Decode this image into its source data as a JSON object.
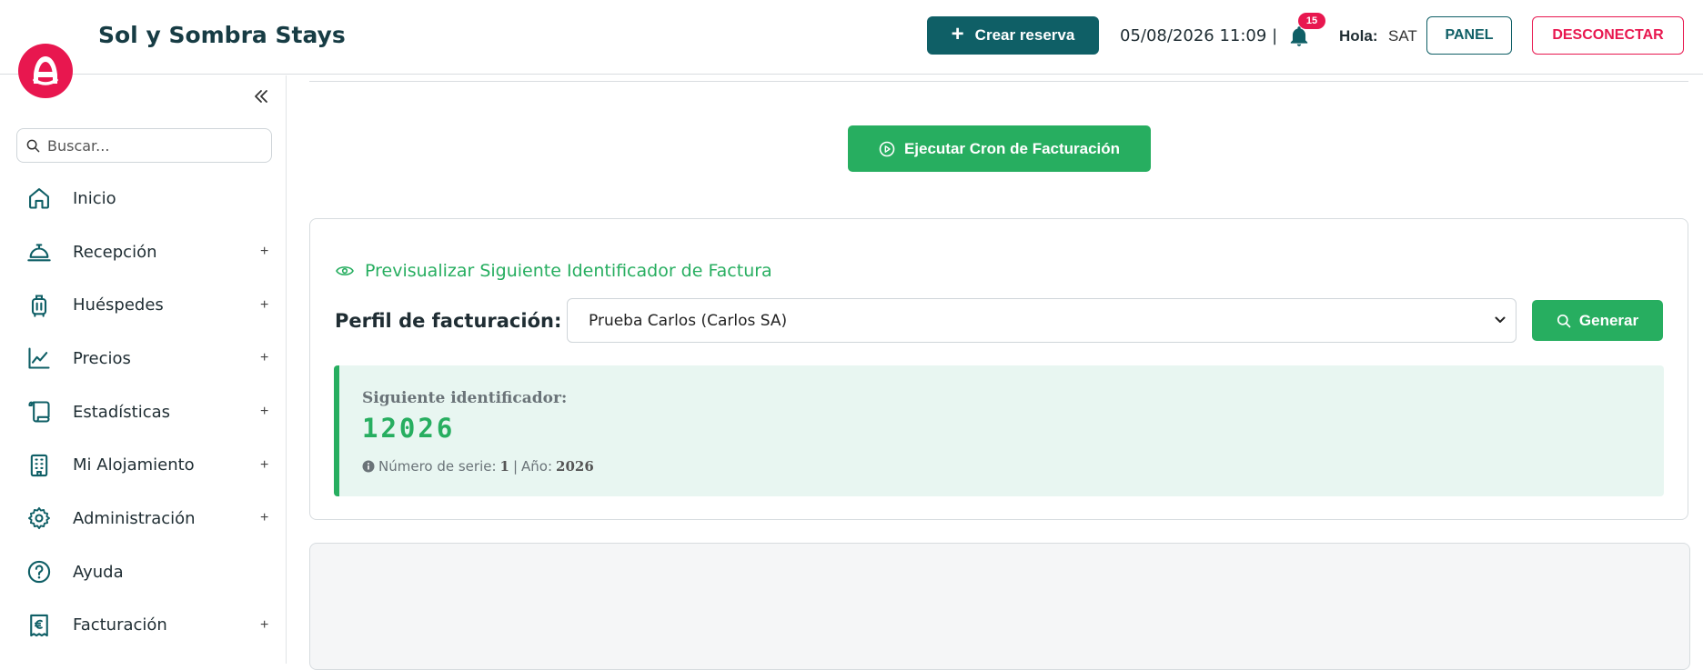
{
  "header": {
    "app_title": "Sol y Sombra Stays",
    "create_button": "Crear reserva",
    "datetime": "05/08/2026 11:09 |",
    "notifications_count": "15",
    "greeting_label": "Hola:",
    "user_name": "SAT",
    "panel_button": "PANEL",
    "logout_button": "DESCONECTAR"
  },
  "sidebar": {
    "search_placeholder": "Buscar...",
    "items": [
      {
        "label": "Inicio",
        "icon": "home-icon",
        "expand": ""
      },
      {
        "label": "Recepción",
        "icon": "bell-desk-icon",
        "expand": "+"
      },
      {
        "label": "Huéspedes",
        "icon": "luggage-icon",
        "expand": "+"
      },
      {
        "label": "Precios",
        "icon": "chart-line-icon",
        "expand": "+"
      },
      {
        "label": "Estadísticas",
        "icon": "scroll-icon",
        "expand": "+"
      },
      {
        "label": "Mi Alojamiento",
        "icon": "building-icon",
        "expand": "+"
      },
      {
        "label": "Administración",
        "icon": "gear-icon",
        "expand": "+"
      },
      {
        "label": "Ayuda",
        "icon": "help-circle-icon",
        "expand": ""
      },
      {
        "label": "Facturación",
        "icon": "receipt-euro-icon",
        "expand": "+"
      }
    ]
  },
  "main": {
    "cron_button": "Ejecutar Cron de Facturación",
    "preview": {
      "title": "Previsualizar Siguiente Identificador de Factura",
      "profile_label": "Perfil de facturación:",
      "profile_selected": "Prueba Carlos (Carlos SA)",
      "generate_button": "Generar",
      "next_label": "Siguiente identificador:",
      "next_value": "12026",
      "series_label": "Número de serie:",
      "series_value": "1",
      "separator": "|",
      "year_label": "Año:",
      "year_value": "2026"
    }
  },
  "colors": {
    "brand": "#e8174f",
    "primary_dark": "#0f5f66",
    "success": "#27ae60",
    "result_bg": "#e8f6f1"
  }
}
